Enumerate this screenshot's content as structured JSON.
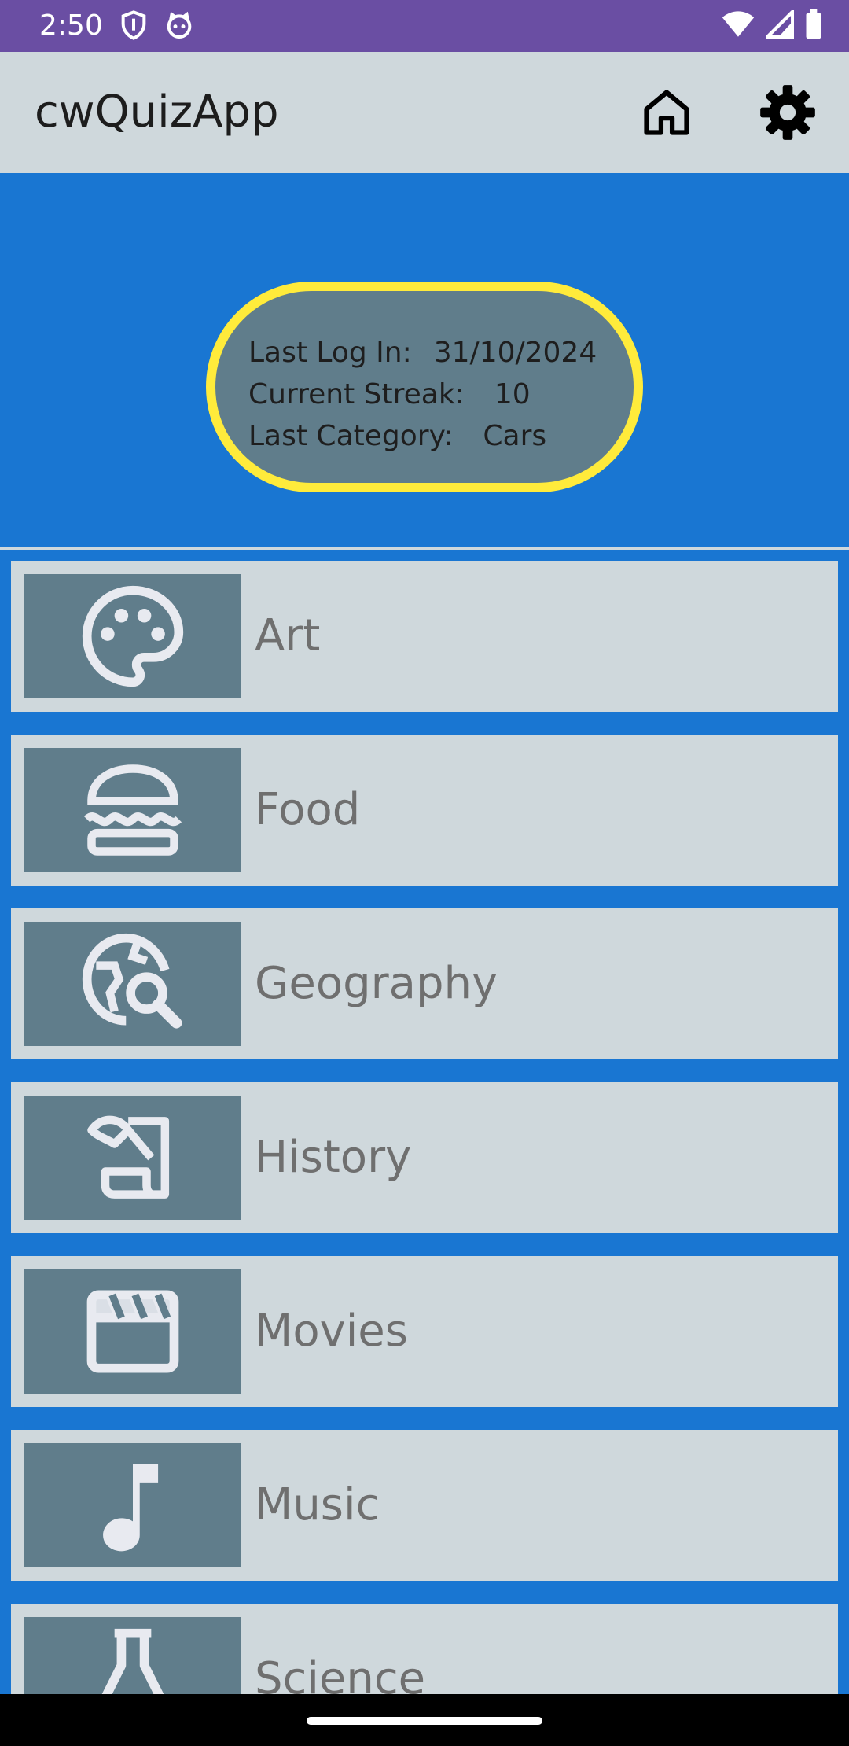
{
  "status_bar": {
    "time": "2:50",
    "left_icons": [
      "shield-icon",
      "cat-face-icon"
    ],
    "right_icons": [
      "wifi-icon",
      "signal-icon",
      "battery-icon"
    ],
    "color": "#6a4ea3"
  },
  "app_bar": {
    "title": "cwQuizApp",
    "actions": [
      "home-icon",
      "gear-icon"
    ]
  },
  "stats": {
    "last_login_label": "Last Log In:",
    "last_login_value": "31/10/2024",
    "streak_label": "Current Streak:",
    "streak_value": "10",
    "last_category_label": "Last Category:",
    "last_category_value": "Cars"
  },
  "categories": [
    {
      "label": "Art",
      "icon": "palette-icon"
    },
    {
      "label": "Food",
      "icon": "burger-icon"
    },
    {
      "label": "Geography",
      "icon": "globe-search-icon"
    },
    {
      "label": "History",
      "icon": "scroll-icon"
    },
    {
      "label": "Movies",
      "icon": "clapperboard-icon"
    },
    {
      "label": "Music",
      "icon": "music-note-icon"
    },
    {
      "label": "Science",
      "icon": "flask-icon"
    }
  ],
  "colors": {
    "background": "#1976d2",
    "card": "#cfd8dc",
    "icon_box": "#607d8b",
    "pill_border": "#ffeb3b",
    "label_text": "#6f6f6f"
  }
}
